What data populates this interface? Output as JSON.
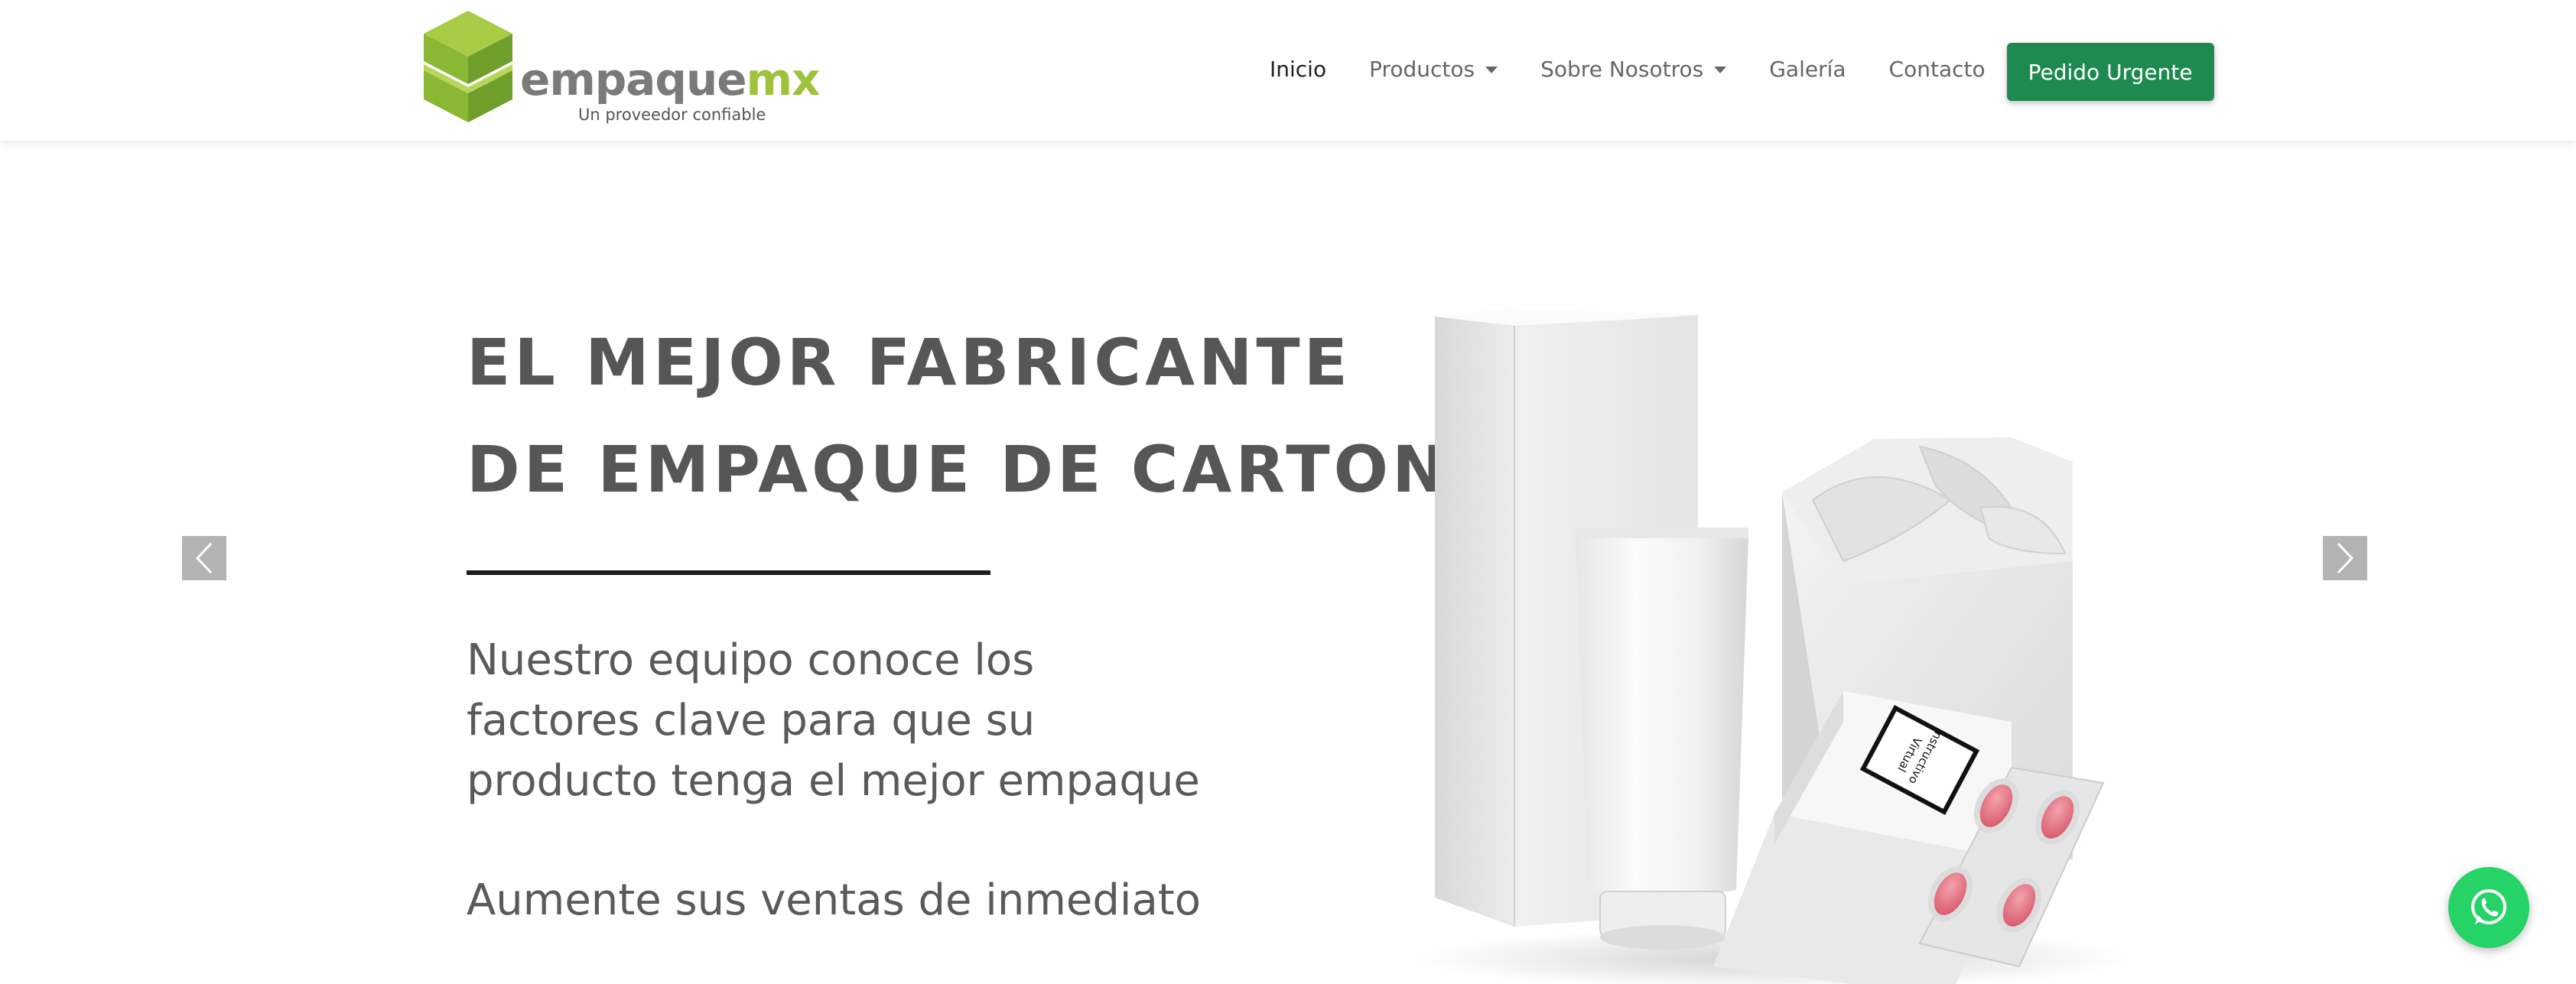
{
  "brand": {
    "name_main": "empaque",
    "name_accent": "mx",
    "tagline": "Un proveedor confiable"
  },
  "nav": {
    "items": [
      {
        "label": "Inicio",
        "active": true,
        "dropdown": false
      },
      {
        "label": "Productos",
        "active": false,
        "dropdown": true
      },
      {
        "label": "Sobre Nosotros",
        "active": false,
        "dropdown": true
      },
      {
        "label": "Galería",
        "active": false,
        "dropdown": false
      },
      {
        "label": "Contacto",
        "active": false,
        "dropdown": false
      }
    ],
    "cta_label": "Pedido Urgente"
  },
  "hero": {
    "title_line1": "EL MEJOR FABRICANTE",
    "title_line2": "DE EMPAQUE DE CARTON",
    "text_line1": "Nuestro equipo conoce los",
    "text_line2": "factores clave para que su",
    "text_line3": "producto tenga el mejor empaque",
    "text2": "Aumente sus ventas de inmediato",
    "box_label_line1": "Instructivo",
    "box_label_line2": "Virtual"
  },
  "icons": {
    "logo": "cube-logo-icon",
    "prev": "chevron-left-icon",
    "next": "chevron-right-icon",
    "whatsapp": "whatsapp-icon"
  },
  "colors": {
    "brand_green_light": "#9cc33b",
    "brand_green_dark": "#5f9a2c",
    "cta_green": "#1e8a4f",
    "whatsapp_green": "#25d366",
    "text_gray": "#565656",
    "pill_pink": "#e06a7a"
  }
}
